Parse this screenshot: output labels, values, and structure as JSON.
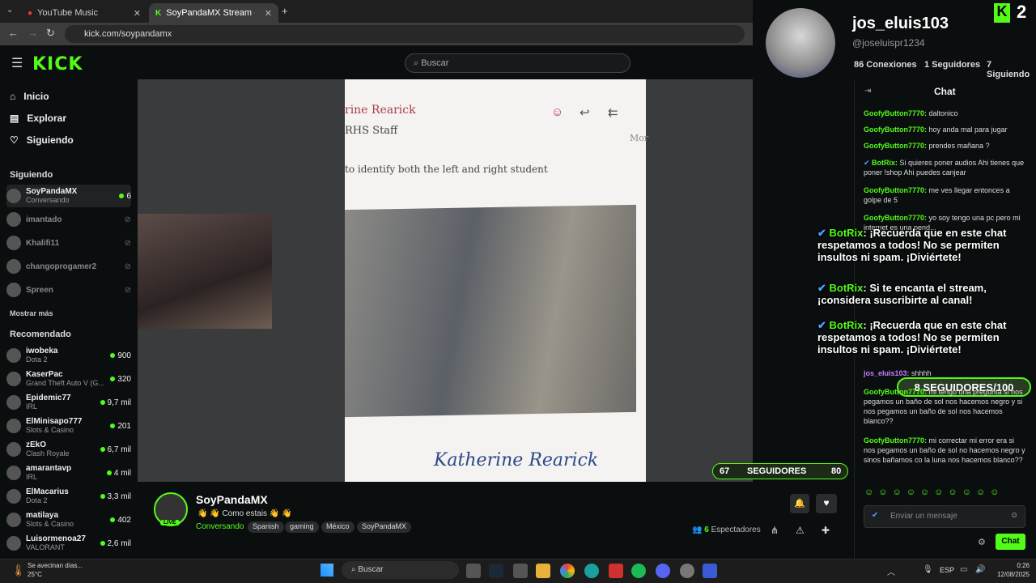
{
  "browser": {
    "tabs": [
      {
        "label": "YouTube Music"
      },
      {
        "label": "SoyPandaMX Stream - Watch L"
      }
    ],
    "url": "kick.com/soypandamx"
  },
  "header": {
    "logo": "KICK",
    "search_placeholder": "Buscar"
  },
  "sidebar": {
    "nav": [
      {
        "label": "Inicio"
      },
      {
        "label": "Explorar"
      },
      {
        "label": "Siguiendo"
      }
    ],
    "following_title": "Siguiendo",
    "following": [
      {
        "name": "SoyPandaMX",
        "sub": "Conversando",
        "count": "6"
      },
      {
        "name": "imantado"
      },
      {
        "name": "Khalifi11"
      },
      {
        "name": "changoprogamer2"
      },
      {
        "name": "Spreen"
      }
    ],
    "show_more": "Mostrar más",
    "recommended_title": "Recomendado",
    "recommended": [
      {
        "name": "iwobeka",
        "sub": "Dota 2",
        "count": "900"
      },
      {
        "name": "KaserPac",
        "sub": "Grand Theft Auto V (G...",
        "count": "320"
      },
      {
        "name": "Epidemic77",
        "sub": "IRL",
        "count": "9,7 mil"
      },
      {
        "name": "ElMinisapo777",
        "sub": "Slots & Casino",
        "count": "201"
      },
      {
        "name": "zEkO",
        "sub": "Clash Royale",
        "count": "6,7 mil"
      },
      {
        "name": "amarantavp",
        "sub": "IRL",
        "count": "4 mil"
      },
      {
        "name": "ElMacarius",
        "sub": "Dota 2",
        "count": "3,3 mil"
      },
      {
        "name": "matilaya",
        "sub": "Slots & Casino",
        "count": "402"
      },
      {
        "name": "Luisormenoa27",
        "sub": "VALORANT",
        "count": "2,6 mil"
      }
    ]
  },
  "video": {
    "doc_name": "rine Rearick",
    "doc_staff": "RHS Staff",
    "doc_more": "Mor",
    "doc_line": "to identify both the left and right student",
    "signature": "Katherine Rearick"
  },
  "stream": {
    "channel": "SoyPandaMX",
    "live": "LIVE",
    "title": "👋 👋 Como estais 👋 👋",
    "category": "Conversando",
    "tags": [
      "Spanish",
      "gaming",
      "México",
      "SoyPandaMX"
    ],
    "viewers": "6",
    "viewers_label": "Espectadores"
  },
  "followers_overlay": {
    "left": "67",
    "label": "SEGUIDORES",
    "right": "80"
  },
  "profile": {
    "name": "jos_eluis103",
    "handle": "@joseluispr1234",
    "stats": "86 Conexiones",
    "followers": "1 Seguidores",
    "following": "7 Siguiendo",
    "badge": "2"
  },
  "chat": {
    "title": "Chat",
    "messages": [
      {
        "user": "GoofyButton7770:",
        "text": " daltonico"
      },
      {
        "user": "GoofyButton7770:",
        "text": " hoy anda mal para jugar"
      },
      {
        "user": "GoofyButton7770:",
        "text": " prendes mañana ?"
      },
      {
        "user": "BotRix:",
        "text": " Si quieres poner audios Ahi tienes que poner !shop Ahi puedes canjear"
      },
      {
        "user": "GoofyButton7770:",
        "text": " me ves llegar entonces a golpe de 5"
      },
      {
        "user": "GoofyButton7770:",
        "text": " yo soy tengo una pc pero mi internet es una pend..."
      }
    ],
    "overlay": [
      {
        "user": "BotRix",
        "text": ": ¡Recuerda que en este chat respetamos a todos! No se permiten insultos ni spam. ¡Diviértete!"
      },
      {
        "user": "BotRix",
        "text": ": Si te encanta el stream, ¡considera suscribirte al canal!"
      },
      {
        "user": "BotRix",
        "text": ": ¡Recuerda que en este chat respetamos a todos! No se permiten insultos ni spam. ¡Diviértete!"
      }
    ],
    "goal": "8 SEGUIDORES/100",
    "lower": [
      {
        "user": "jos_eluis103:",
        "text": " shhhh"
      },
      {
        "user": "GoofyButton7770:",
        "text": " mi tengo una pregunta si nos pegamos un baño de sol nos hacemos negro y si nos pegamos un baño de sol nos hacemos blanco??"
      },
      {
        "user": "GoofyButton7770:",
        "text": " mi correctar mi error era si nos pegamos un baño de sol no hacemos negro y sinos bañamos co la luna nos hacemos blanco??"
      }
    ],
    "input_placeholder": "Enviar un mensaje",
    "send": "Chat"
  },
  "taskbar": {
    "weather": "Se avecinan días...",
    "temp": "25°C",
    "search": "Buscar",
    "lang": "ESP",
    "time": "0:26",
    "date": "12/08/2025"
  }
}
